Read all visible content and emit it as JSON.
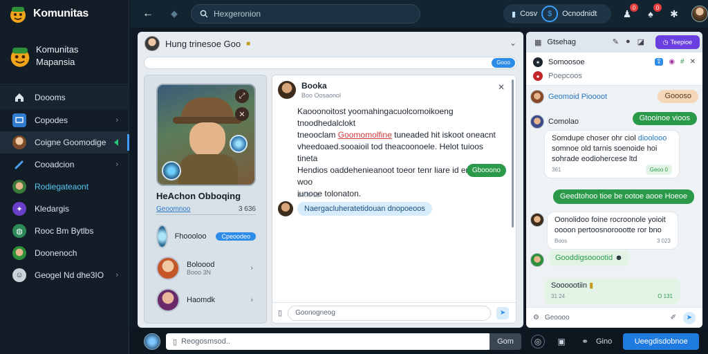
{
  "app": {
    "brand_name": "Komunitas",
    "brand_block_line1": "Komunitas",
    "brand_block_line2": "Mapansia",
    "brand_color": "#f2a51a"
  },
  "sidebar": {
    "items": [
      {
        "label": "Doooms",
        "icon": "home-icon",
        "state": "highlight"
      },
      {
        "label": "Copodes",
        "icon": "monitor-icon",
        "state": "normal",
        "chevron": true
      },
      {
        "label": "Coigne Goomodige",
        "icon": "avatar-icon",
        "state": "active",
        "marker": true
      },
      {
        "label": "Cooadcion",
        "icon": "sword-icon",
        "state": "normal",
        "chevron": true
      },
      {
        "label": "Rodiegateaont",
        "icon": "avatar-icon",
        "state": "teal"
      },
      {
        "label": "Kledargis",
        "icon": "puzzle-icon",
        "state": "normal"
      },
      {
        "label": "Rooc Bm Bytlbs",
        "icon": "globe-icon",
        "state": "normal"
      },
      {
        "label": "Doonenoch",
        "icon": "avatar-icon",
        "state": "normal"
      },
      {
        "label": "Geogel Nd dhe3IO",
        "icon": "smiley-icon",
        "state": "normal",
        "chevron": true
      }
    ]
  },
  "topbar": {
    "search_placeholder": "Hexgeronion",
    "user_left": "Cosv",
    "user_right": "Ocnodnidt",
    "notif_badge_1": "0",
    "notif_badge_2": "0"
  },
  "main": {
    "header_title": "Hung trinesoe  Goo",
    "go_label": "Gooo",
    "card": {
      "title": "HeAchon Obboqing",
      "link": "Geoomnoo",
      "count": "3 636",
      "friends": [
        {
          "name": "Fhoooloo",
          "chip": "Cpeoodeo",
          "sub": ""
        },
        {
          "name": "Boloood",
          "chip": "",
          "sub": "Booo 3N"
        },
        {
          "name": "Haomdk",
          "chip": "",
          "sub": ""
        }
      ]
    },
    "chat": {
      "name": "Booka",
      "status": "Boo Oosaonol",
      "message_1": "Kaooonoitost yoomahingacuolcomoikoeng tnoodhedalclokt",
      "message_2a": "tneooclam",
      "message_2_link": "Goomomolfine",
      "message_2b": "tuneaded hit iskoot oneacnt",
      "message_3": "vheedoaed.sooaioil tod theacoonoele. Helot tuioos tineta",
      "message_4": "Hendios oaddehenieanoot toeor tenr liare id eneaolo woo",
      "message_5": "iunooe tolonaton.",
      "reply": "Gbooono",
      "time": "1000  11",
      "incoming": "Naergacluheratetidouan dnopoeoos",
      "compose_placeholder": "Goonogneog"
    }
  },
  "right": {
    "title": "Gtsehag",
    "action_button": "Teepioe",
    "info_title": "Somoosoe",
    "info_sub": "Poepcoos",
    "thread": {
      "tag_left": "Geomoid Pioooot",
      "tag_right": "Goooso",
      "msg_header_name": "Comolao",
      "green_top": "Gtooinoe vioos",
      "white_1a": "Somdupe choser ohr ciol",
      "white_1_link": "dioolooo",
      "white_1b": "somnoe old tarnis soenoide hoi",
      "white_1c": "sohrade eodiohercese ltd",
      "white_1_meta": "361",
      "white_1_tag": "Geoo 0",
      "green_wide": "Geedtohoo tioe be ootoe aooe Hoeoe",
      "white_2a": "Oonolidoo foine rocroonole yoioit",
      "white_2b": "oooon pertoosnoroootte ror bno",
      "white_2_meta_l": "Boos",
      "white_2_meta_r": "3 023",
      "lgreen_1": "Gooddigsooootid",
      "lgreen_2a": "Soooootiin",
      "lgreen_2_meta_l": "31 24",
      "lgreen_2_meta_r": "O 131",
      "compose_placeholder": "Geoooo"
    }
  },
  "bottombar": {
    "input_placeholder": "Reogosmsod..",
    "send_label": "Gom",
    "text_label": "Gino",
    "primary_button": "Ueegdisdobnoe"
  }
}
